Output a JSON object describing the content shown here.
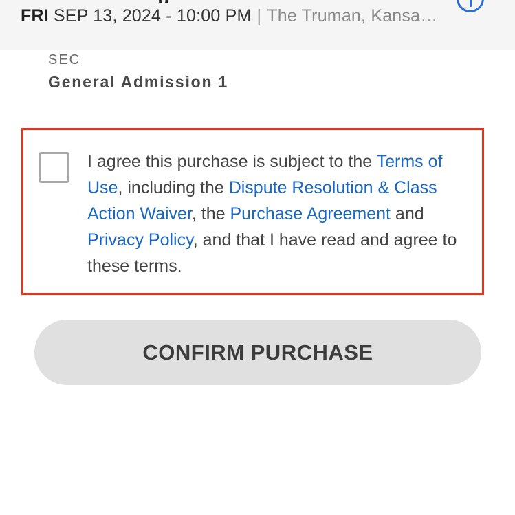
{
  "event": {
    "title_fragment": "g",
    "day": "FRI",
    "datetime": "SEP 13, 2024 - 10:00 PM",
    "separator": "|",
    "venue": "The Truman, Kansa…"
  },
  "icons": {
    "info": "info-icon"
  },
  "section": {
    "label": "SEC",
    "value": "General Admission 1"
  },
  "terms": {
    "checked": false,
    "text_1": "I agree this purchase is subject to the ",
    "link_terms_of_use": "Terms of Use",
    "text_2": ", including the ",
    "link_dispute": "Dispute Resolution & Class Action Waiver",
    "text_3": ", the ",
    "link_purchase_agreement": "Purchase Agreement",
    "text_4": " and ",
    "link_privacy": "Privacy Policy",
    "text_5": ", and that I have read and agree to these terms."
  },
  "confirm_button": {
    "label": "CONFIRM PURCHASE"
  },
  "colors": {
    "link": "#1a68c2",
    "highlight_border": "#e5341d",
    "info_icon": "#2a6fd6",
    "button_bg": "#e0e0e0"
  }
}
